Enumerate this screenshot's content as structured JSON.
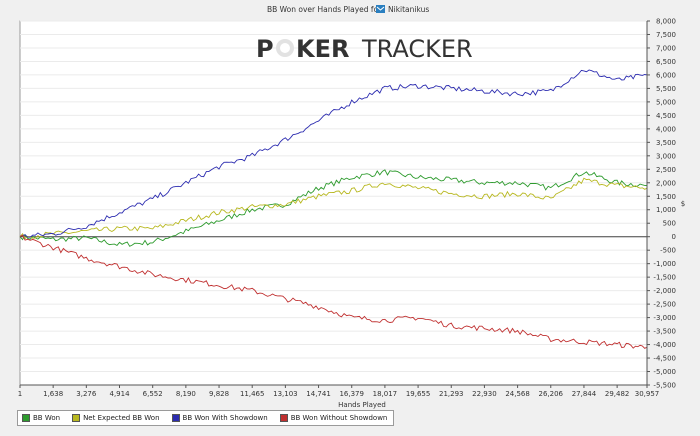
{
  "chart_data": {
    "type": "line",
    "title": "BB Won over Hands Played for",
    "player_name": "Nikitanikus",
    "watermark": {
      "part1": "P",
      "part2": "KER",
      "part3": "TRACKER"
    },
    "xlabel": "Hands Played",
    "ylabel": "$",
    "xlim": [
      1,
      30957
    ],
    "ylim": [
      -5500,
      8000
    ],
    "x_ticks": [
      1,
      1638,
      3276,
      4914,
      6552,
      8190,
      9828,
      11465,
      13103,
      14741,
      16379,
      18017,
      19655,
      21293,
      22930,
      24568,
      26206,
      27844,
      29482,
      30957
    ],
    "x_tick_labels": [
      "1",
      "1,638",
      "3,276",
      "4,914",
      "6,552",
      "8,190",
      "9,828",
      "11,465",
      "13,103",
      "14,741",
      "16,379",
      "18,017",
      "19,655",
      "21,293",
      "22,930",
      "24,568",
      "26,206",
      "27,844",
      "29,482",
      "30,957"
    ],
    "y_ticks": [
      8000,
      7500,
      7000,
      6500,
      6000,
      5500,
      5000,
      4500,
      4000,
      3500,
      3000,
      2500,
      2000,
      1500,
      1000,
      500,
      0,
      -500,
      -1000,
      -1500,
      -2000,
      -2500,
      -3000,
      -3500,
      -4000,
      -4500,
      -5000,
      -5500
    ],
    "y_tick_labels": [
      "8,000",
      "7,500",
      "7,000",
      "6,500",
      "6,000",
      "5,500",
      "5,000",
      "4,500",
      "4,000",
      "3,500",
      "3,000",
      "2,500",
      "2,000",
      "1,500",
      "1,000",
      "500",
      "0",
      "-500",
      "-1,000",
      "-1,500",
      "-2,000",
      "-2,500",
      "-3,000",
      "-3,500",
      "-4,000",
      "-4,500",
      "-5,000",
      "-5,500"
    ],
    "grid": true,
    "legend_position": "bottom-left",
    "x": [
      1,
      1638,
      3276,
      4914,
      6552,
      8190,
      9828,
      11465,
      13103,
      14741,
      16379,
      18017,
      19655,
      21293,
      22930,
      24568,
      26206,
      27844,
      29482,
      30957
    ],
    "series": [
      {
        "name": "BB Won",
        "color": "#2e9b2e",
        "values": [
          0,
          -100,
          -50,
          -300,
          -200,
          200,
          600,
          1000,
          1200,
          1800,
          2200,
          2400,
          2200,
          2100,
          2000,
          2000,
          1800,
          2400,
          2000,
          1900
        ]
      },
      {
        "name": "Net Expected BB Won",
        "color": "#b8b820",
        "values": [
          0,
          100,
          200,
          300,
          300,
          600,
          900,
          1100,
          1200,
          1500,
          1700,
          2000,
          1800,
          1600,
          1500,
          1600,
          1400,
          2100,
          1900,
          1800
        ]
      },
      {
        "name": "BB Won With Showdown",
        "color": "#2c2cb0",
        "values": [
          0,
          100,
          400,
          900,
          1400,
          2000,
          2600,
          3000,
          3600,
          4300,
          5000,
          5500,
          5600,
          5500,
          5400,
          5300,
          5400,
          6200,
          5800,
          6000
        ]
      },
      {
        "name": "BB Won Without Showdown",
        "color": "#c03030",
        "values": [
          0,
          -400,
          -800,
          -1100,
          -1400,
          -1600,
          -1800,
          -2000,
          -2300,
          -2600,
          -3000,
          -3100,
          -3000,
          -3300,
          -3400,
          -3500,
          -3800,
          -3900,
          -4000,
          -4100
        ]
      }
    ]
  }
}
